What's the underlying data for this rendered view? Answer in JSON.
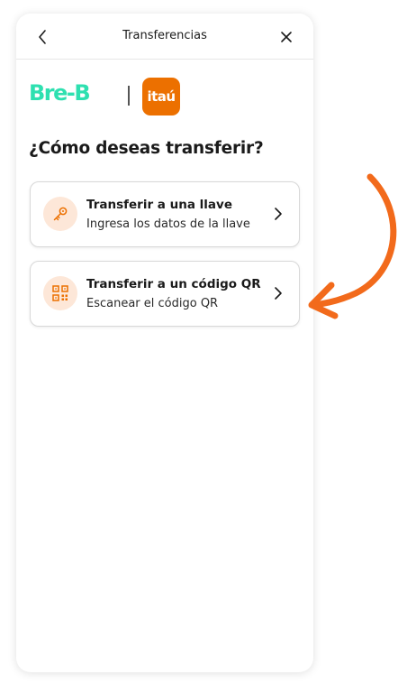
{
  "header": {
    "title": "Transferencias",
    "back_icon": "chevron-left-icon",
    "close_icon": "close-icon"
  },
  "brand": {
    "bre_b": "Bre-B",
    "itau": "itaú",
    "bre_b_color": "#2ee0b0",
    "itau_color": "#ec7000"
  },
  "main": {
    "question": "¿Cómo deseas transferir?",
    "options": [
      {
        "title": "Transferir a una llave",
        "subtitle": "Ingresa los datos de la llave",
        "icon": "key-icon"
      },
      {
        "title": "Transferir a un código QR",
        "subtitle": "Escanear el código QR",
        "icon": "qr-code-icon"
      }
    ]
  },
  "colors": {
    "accent": "#ec7000",
    "icon_bg": "#fde7d8",
    "annotation_arrow": "#f26a1b"
  }
}
